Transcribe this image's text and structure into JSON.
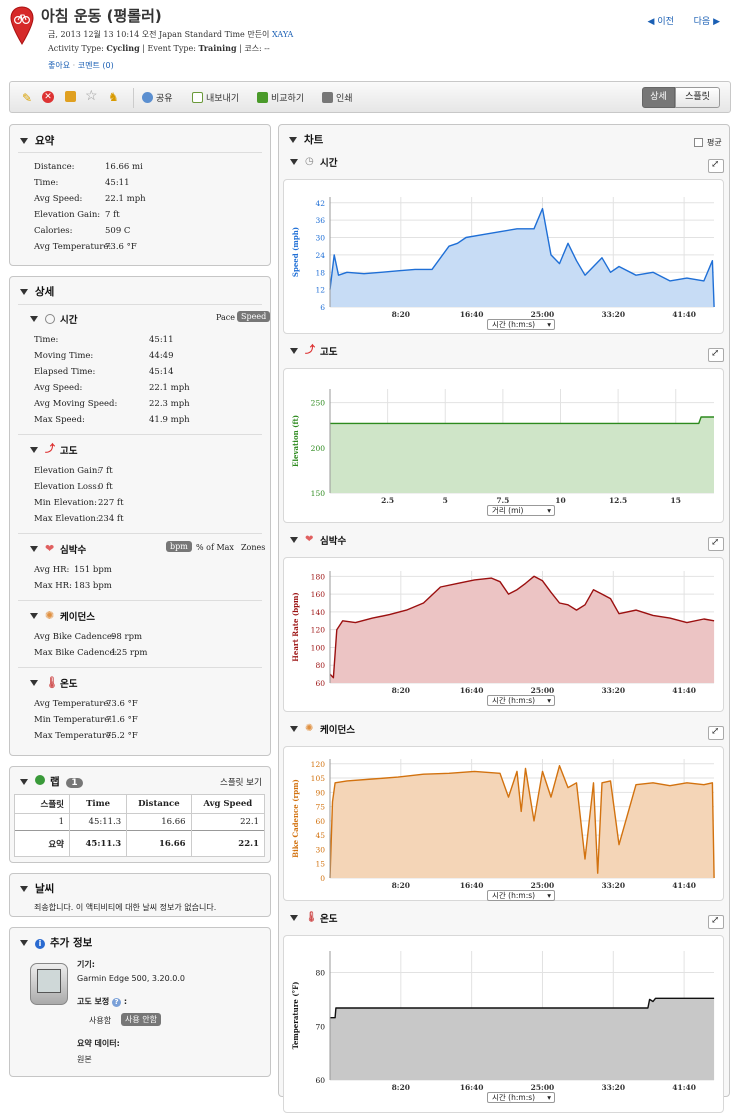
{
  "header": {
    "title": "아침 운동 (평롤러)",
    "date_line_prefix": "금, 2013 12월 13 10:14 오전 Japan Standard Time 만든이",
    "author": "XAYA",
    "activity_type_label": "Activity Type:",
    "activity_type": "Cycling",
    "event_type_label": "| Event Type:",
    "event_type": "Training",
    "course_label": "| 코스: --",
    "like_label": "좋아요",
    "comments_label": "코멘트 (0)",
    "prev_label": "이전",
    "next_label": "다음"
  },
  "toolbar": {
    "share": "공유",
    "export": "내보내기",
    "compare": "비교하기",
    "print": "인쇄",
    "detail": "상세",
    "split": "스플릿"
  },
  "summary": {
    "title": "요약",
    "rows": [
      {
        "label": "Distance:",
        "value": "16.66 mi"
      },
      {
        "label": "Time:",
        "value": "45:11"
      },
      {
        "label": "Avg Speed:",
        "value": "22.1 mph"
      },
      {
        "label": "Elevation Gain:",
        "value": "7 ft"
      },
      {
        "label": "Calories:",
        "value": "509 C"
      },
      {
        "label": "Avg Temperature:",
        "value": "73.6 °F"
      }
    ]
  },
  "details": {
    "title": "상세",
    "time": {
      "title": "시간",
      "pace": "Pace",
      "speed": "Speed",
      "rows": [
        {
          "label": "Time:",
          "value": "45:11"
        },
        {
          "label": "Moving Time:",
          "value": "44:49"
        },
        {
          "label": "Elapsed Time:",
          "value": "45:14"
        },
        {
          "label": "Avg Speed:",
          "value": "22.1 mph"
        },
        {
          "label": "Avg Moving Speed:",
          "value": "22.3 mph"
        },
        {
          "label": "Max Speed:",
          "value": "41.9 mph"
        }
      ]
    },
    "elevation": {
      "title": "고도",
      "rows": [
        {
          "label": "Elevation Gain:",
          "value": "7 ft"
        },
        {
          "label": "Elevation Loss:",
          "value": "0 ft"
        },
        {
          "label": "Min Elevation:",
          "value": "227 ft"
        },
        {
          "label": "Max Elevation:",
          "value": "234 ft"
        }
      ]
    },
    "heartrate": {
      "title": "심박수",
      "bpm": "bpm",
      "pct_max": "% of Max",
      "zones": "Zones",
      "rows": [
        {
          "label": "Avg HR:",
          "value": "151 bpm"
        },
        {
          "label": "Max HR:",
          "value": "183 bpm"
        }
      ]
    },
    "cadence": {
      "title": "케이던스",
      "rows": [
        {
          "label": "Avg Bike Cadence:",
          "value": "98 rpm"
        },
        {
          "label": "Max Bike Cadence:",
          "value": "125 rpm"
        }
      ]
    },
    "temperature": {
      "title": "온도",
      "rows": [
        {
          "label": "Avg Temperature:",
          "value": "73.6 °F"
        },
        {
          "label": "Min Temperature:",
          "value": "71.6 °F"
        },
        {
          "label": "Max Temperature:",
          "value": "75.2 °F"
        }
      ]
    }
  },
  "laps": {
    "title": "랩",
    "count": "1",
    "view_splits": "스플릿 보기",
    "headers": [
      "스플릿",
      "Time",
      "Distance",
      "Avg Speed"
    ],
    "rows": [
      [
        "1",
        "45:11.3",
        "16.66",
        "22.1"
      ]
    ],
    "total": [
      "요약",
      "45:11.3",
      "16.66",
      "22.1"
    ]
  },
  "weather": {
    "title": "날씨",
    "message": "죄송합니다. 이 액티비티에 대한 날씨 정보가 없습니다."
  },
  "extra": {
    "title": "추가 정보",
    "device_label": "기기:",
    "device": "Garmin Edge 500, 3.20.0.0",
    "elev_corr_label": "고도 보정",
    "use": "사용함",
    "not_use": "사용 안함",
    "summary_data_label": "요약 데이터:",
    "summary_data": "원본"
  },
  "charts_panel": {
    "title": "차트",
    "average_label": "평균"
  },
  "colors": {
    "speed": "#1f6fd6",
    "elevation": "#2d8a1e",
    "heart": "#9b1010",
    "cadence": "#d2720f",
    "temp": "#111111"
  },
  "chart_data": [
    {
      "type": "area",
      "section_title": "시간",
      "ylabel": "Speed (mph)",
      "xlabel": "시간 (h:m:s)",
      "x_ticks": [
        "8:20",
        "16:40",
        "25:00",
        "33:20",
        "41:40"
      ],
      "y_ticks": [
        6,
        12,
        18,
        24,
        30,
        36,
        42
      ],
      "xlim_seconds": [
        0,
        2711
      ],
      "ylim": [
        6,
        44
      ],
      "x_minutes": [
        0,
        0.5,
        1,
        2,
        4,
        6,
        8,
        10,
        12,
        14,
        15,
        16,
        18,
        20,
        22,
        24,
        25,
        26,
        27,
        28,
        29,
        30,
        32,
        33,
        34,
        36,
        38,
        40,
        42,
        44,
        45,
        45.2
      ],
      "values": [
        12,
        24,
        17,
        18,
        17.5,
        18,
        18.5,
        19,
        19,
        27,
        28,
        30,
        31,
        32,
        33,
        33,
        40,
        24,
        21,
        28,
        22,
        17,
        23,
        18,
        20,
        17,
        18,
        15,
        16,
        15,
        22,
        6
      ]
    },
    {
      "type": "area",
      "section_title": "고도",
      "ylabel": "Elevation (ft)",
      "xlabel": "거리 (mi)",
      "x_ticks": [
        "2.5",
        "5",
        "7.5",
        "10",
        "12.5",
        "15"
      ],
      "y_ticks": [
        150,
        200,
        250
      ],
      "xlim": [
        0,
        16.66
      ],
      "ylim": [
        150,
        265
      ],
      "x": [
        0,
        16.0,
        16.1,
        16.66
      ],
      "values": [
        227,
        227,
        234,
        234
      ]
    },
    {
      "type": "area",
      "section_title": "심박수",
      "ylabel": "Heart Rate (bpm)",
      "xlabel": "시간 (h:m:s)",
      "x_ticks": [
        "8:20",
        "16:40",
        "25:00",
        "33:20",
        "41:40"
      ],
      "y_ticks": [
        60,
        80,
        100,
        120,
        140,
        160,
        180
      ],
      "xlim_seconds": [
        0,
        2711
      ],
      "ylim": [
        60,
        186
      ],
      "x_minutes": [
        0,
        0.4,
        0.8,
        1.5,
        3,
        5,
        7,
        9,
        11,
        13,
        15,
        17,
        19,
        20,
        21,
        22,
        23,
        24,
        25,
        26,
        27,
        28,
        29,
        30,
        31,
        32,
        33,
        34,
        36,
        38,
        40,
        42,
        44,
        45.2
      ],
      "values": [
        70,
        66,
        120,
        130,
        128,
        133,
        137,
        142,
        150,
        168,
        172,
        176,
        178,
        174,
        160,
        165,
        172,
        180,
        175,
        162,
        150,
        148,
        142,
        148,
        165,
        160,
        155,
        138,
        142,
        136,
        133,
        128,
        132,
        130
      ]
    },
    {
      "type": "area",
      "section_title": "케이던스",
      "ylabel": "Bike Cadence (rpm)",
      "xlabel": "시간 (h:m:s)",
      "x_ticks": [
        "8:20",
        "16:40",
        "25:00",
        "33:20",
        "41:40"
      ],
      "y_ticks": [
        0,
        15,
        30,
        45,
        60,
        75,
        90,
        105,
        120
      ],
      "xlim_seconds": [
        0,
        2711
      ],
      "ylim": [
        0,
        125
      ],
      "x_minutes": [
        0,
        0.3,
        0.6,
        2,
        5,
        8,
        11,
        14,
        17,
        20,
        21,
        22,
        22.5,
        23,
        24,
        25,
        26,
        27,
        28,
        29,
        30,
        31,
        31.5,
        32,
        33,
        34,
        36,
        38,
        40,
        42,
        44,
        45,
        45.2
      ],
      "values": [
        0,
        80,
        100,
        102,
        104,
        106,
        109,
        110,
        112,
        110,
        85,
        112,
        70,
        115,
        60,
        112,
        85,
        118,
        95,
        100,
        20,
        100,
        5,
        100,
        102,
        35,
        98,
        100,
        97,
        100,
        98,
        100,
        0
      ]
    },
    {
      "type": "area",
      "section_title": "온도",
      "ylabel": "Temperature (°F)",
      "xlabel": "시간 (h:m:s)",
      "x_ticks": [
        "8:20",
        "16:40",
        "25:00",
        "33:20",
        "41:40"
      ],
      "y_ticks": [
        60,
        70,
        80
      ],
      "xlim_seconds": [
        0,
        2711
      ],
      "ylim": [
        60,
        84
      ],
      "x_minutes": [
        0,
        0.6,
        0.7,
        37.4,
        37.6,
        38,
        38.3,
        45.2
      ],
      "values": [
        71.6,
        71.6,
        73.4,
        73.4,
        75,
        74.6,
        75.2,
        75.2
      ]
    }
  ]
}
